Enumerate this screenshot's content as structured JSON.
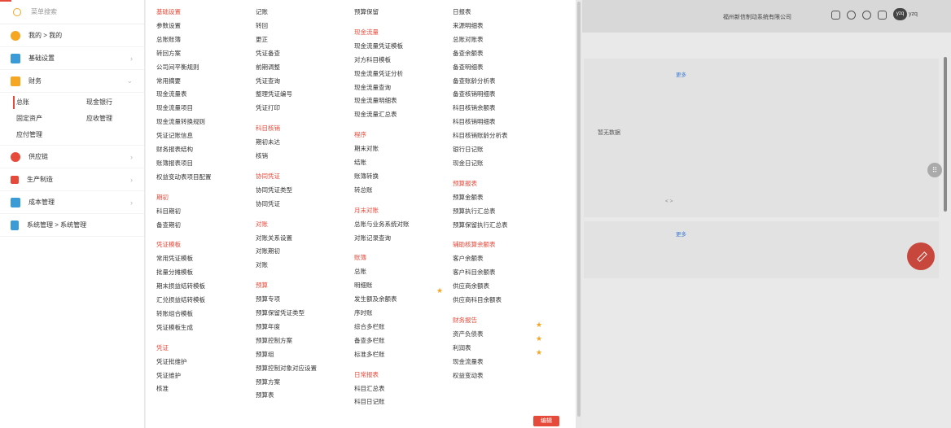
{
  "sidebar": {
    "search_placeholder": "菜单搜索",
    "my": "我的 > 我的",
    "basic": "基础设置",
    "finance": "财务",
    "finance_sub": [
      "总账",
      "现金银行",
      "固定资产",
      "应收管理",
      "应付管理"
    ],
    "supply": "供应链",
    "production": "生产制造",
    "cost": "成本管理",
    "system": "系统管理 > 系统管理"
  },
  "menu": {
    "col1": [
      {
        "t": "h",
        "v": "基础设置"
      },
      {
        "t": "i",
        "v": "参数设置"
      },
      {
        "t": "i",
        "v": "总账账簿"
      },
      {
        "t": "i",
        "v": "转回方案"
      },
      {
        "t": "i",
        "v": "公司间平衡规则"
      },
      {
        "t": "i",
        "v": "常用摘要"
      },
      {
        "t": "i",
        "v": "现金流量表"
      },
      {
        "t": "i",
        "v": "现金流量项目"
      },
      {
        "t": "i",
        "v": "现金流量转换规则"
      },
      {
        "t": "i",
        "v": "凭证记账信息"
      },
      {
        "t": "i",
        "v": "财务报表结构"
      },
      {
        "t": "i",
        "v": "账簿报表项目"
      },
      {
        "t": "i",
        "v": "权益变动表项目配置"
      },
      {
        "t": "h",
        "v": "期初"
      },
      {
        "t": "i",
        "v": "科目期初"
      },
      {
        "t": "i",
        "v": "备查期初"
      },
      {
        "t": "h",
        "v": "凭证模板"
      },
      {
        "t": "i",
        "v": "常用凭证模板"
      },
      {
        "t": "i",
        "v": "批量分摊模板"
      },
      {
        "t": "i",
        "v": "期末损益结转模板"
      },
      {
        "t": "i",
        "v": "汇兑损益结转模板"
      },
      {
        "t": "i",
        "v": "转账组合模板"
      },
      {
        "t": "i",
        "v": "凭证模板生成"
      },
      {
        "t": "h",
        "v": "凭证"
      },
      {
        "t": "i",
        "v": "凭证批维护"
      },
      {
        "t": "i",
        "v": "凭证维护"
      },
      {
        "t": "i",
        "v": "核准"
      }
    ],
    "col2": [
      {
        "t": "i",
        "v": "记账"
      },
      {
        "t": "i",
        "v": "转回"
      },
      {
        "t": "i",
        "v": "更正"
      },
      {
        "t": "i",
        "v": "凭证备查"
      },
      {
        "t": "i",
        "v": "前期调整"
      },
      {
        "t": "i",
        "v": "凭证查询"
      },
      {
        "t": "i",
        "v": "整理凭证编号"
      },
      {
        "t": "i",
        "v": "凭证打印"
      },
      {
        "t": "h",
        "v": "科目核销"
      },
      {
        "t": "i",
        "v": "期初未达"
      },
      {
        "t": "i",
        "v": "核销"
      },
      {
        "t": "h",
        "v": "协同凭证"
      },
      {
        "t": "i",
        "v": "协同凭证类型"
      },
      {
        "t": "i",
        "v": "协同凭证"
      },
      {
        "t": "h",
        "v": "对账"
      },
      {
        "t": "i",
        "v": "对账关系设置"
      },
      {
        "t": "i",
        "v": "对账期初"
      },
      {
        "t": "i",
        "v": "对账"
      },
      {
        "t": "h",
        "v": "预算"
      },
      {
        "t": "i",
        "v": "预算专项"
      },
      {
        "t": "i",
        "v": "预算保留凭证类型"
      },
      {
        "t": "i",
        "v": "预算年度"
      },
      {
        "t": "i",
        "v": "预算控制方案"
      },
      {
        "t": "i",
        "v": "预算组"
      },
      {
        "t": "i",
        "v": "预算控制对象对应设置"
      },
      {
        "t": "i",
        "v": "预算方案"
      },
      {
        "t": "i",
        "v": "预算表"
      }
    ],
    "col3": [
      {
        "t": "i",
        "v": "预算保留"
      },
      {
        "t": "h",
        "v": "现金流量"
      },
      {
        "t": "i",
        "v": "现金流量凭证模板"
      },
      {
        "t": "i",
        "v": "对方科目模板"
      },
      {
        "t": "i",
        "v": "现金流量凭证分析"
      },
      {
        "t": "i",
        "v": "现金流量查询"
      },
      {
        "t": "i",
        "v": "现金流量明细表"
      },
      {
        "t": "i",
        "v": "现金流量汇总表"
      },
      {
        "t": "h",
        "v": "程序"
      },
      {
        "t": "i",
        "v": "期末对账"
      },
      {
        "t": "i",
        "v": "结账"
      },
      {
        "t": "i",
        "v": "账簿转换"
      },
      {
        "t": "i",
        "v": "转总账"
      },
      {
        "t": "h",
        "v": "月末对账"
      },
      {
        "t": "i",
        "v": "总账与业务系统对账"
      },
      {
        "t": "i",
        "v": "对账记录查询"
      },
      {
        "t": "h",
        "v": "账簿"
      },
      {
        "t": "i",
        "v": "总账"
      },
      {
        "t": "i",
        "v": "明细账"
      },
      {
        "t": "i",
        "v": "发生额及余额表"
      },
      {
        "t": "i",
        "v": "序时账"
      },
      {
        "t": "i",
        "v": "综合多栏账"
      },
      {
        "t": "i",
        "v": "备查多栏账"
      },
      {
        "t": "i",
        "v": "标准多栏账"
      },
      {
        "t": "h",
        "v": "日常报表"
      },
      {
        "t": "i",
        "v": "科目汇总表"
      },
      {
        "t": "i",
        "v": "科目日记账"
      }
    ],
    "col4": [
      {
        "t": "i",
        "v": "日报表"
      },
      {
        "t": "i",
        "v": "来源明细表"
      },
      {
        "t": "i",
        "v": "总账对账表"
      },
      {
        "t": "i",
        "v": "备查余额表"
      },
      {
        "t": "i",
        "v": "备查明细表"
      },
      {
        "t": "i",
        "v": "备查账龄分析表"
      },
      {
        "t": "i",
        "v": "备查核销明细表"
      },
      {
        "t": "i",
        "v": "科目核销余额表"
      },
      {
        "t": "i",
        "v": "科目核销明细表"
      },
      {
        "t": "i",
        "v": "科目核销账龄分析表"
      },
      {
        "t": "i",
        "v": "银行日记账"
      },
      {
        "t": "i",
        "v": "现金日记账"
      },
      {
        "t": "h",
        "v": "预算报表"
      },
      {
        "t": "i",
        "v": "预算金额表"
      },
      {
        "t": "i",
        "v": "预算执行汇总表"
      },
      {
        "t": "i",
        "v": "预算保留执行汇总表"
      },
      {
        "t": "h",
        "v": "辅助核算余额表"
      },
      {
        "t": "i",
        "v": "客户余额表"
      },
      {
        "t": "i",
        "v": "客户科目余额表"
      },
      {
        "t": "i",
        "v": "供应商余额表"
      },
      {
        "t": "i",
        "v": "供应商科目余额表"
      },
      {
        "t": "h",
        "v": "财务报告"
      },
      {
        "t": "i",
        "v": "资产负债表"
      },
      {
        "t": "i",
        "v": "利润表"
      },
      {
        "t": "i",
        "v": "现金流量表"
      },
      {
        "t": "i",
        "v": "权益变动表"
      }
    ],
    "edit_button": "编辑"
  },
  "background": {
    "company": "福州新信制动系统有限公司",
    "avatar": "yzq",
    "username": "yzq",
    "more1": "更多",
    "more2": "更多",
    "no_data": "暂无数据",
    "pager": "<   >"
  }
}
